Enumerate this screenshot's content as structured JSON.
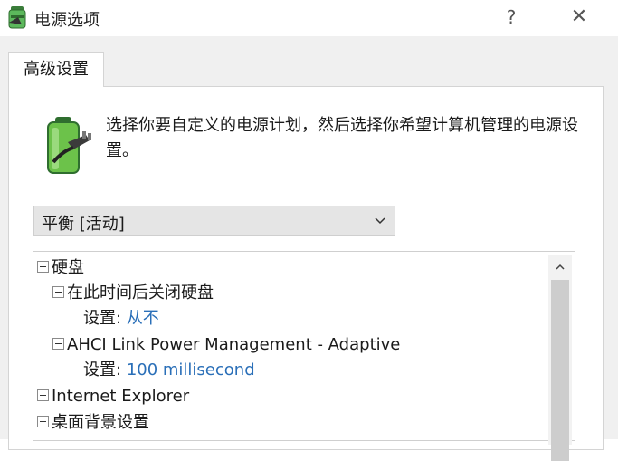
{
  "window": {
    "title": "电源选项",
    "help_label": "?",
    "close_label": "✕"
  },
  "tab": {
    "label": "高级设置"
  },
  "description": "选择你要自定义的电源计划，然后选择你希望计算机管理的电源设置。",
  "plan_select": {
    "value": "平衡 [活动]"
  },
  "tree": {
    "items": [
      {
        "label": "硬盘",
        "expanded": true
      },
      {
        "label": "在此时间后关闭硬盘",
        "expanded": true
      },
      {
        "setting_label": "设置:",
        "setting_value": "从不"
      },
      {
        "label": "AHCI Link Power Management - Adaptive",
        "expanded": true
      },
      {
        "setting_label": "设置:",
        "setting_value": "100 millisecond"
      },
      {
        "label": "Internet Explorer",
        "expanded": false
      },
      {
        "label": "桌面背景设置",
        "expanded": false
      }
    ]
  },
  "scroll": {
    "up_label": "^"
  },
  "colors": {
    "value_text": "#2a6fb8",
    "dropdown_bg": "#e5e5e5",
    "dialog_bg": "#f0f0f0"
  }
}
